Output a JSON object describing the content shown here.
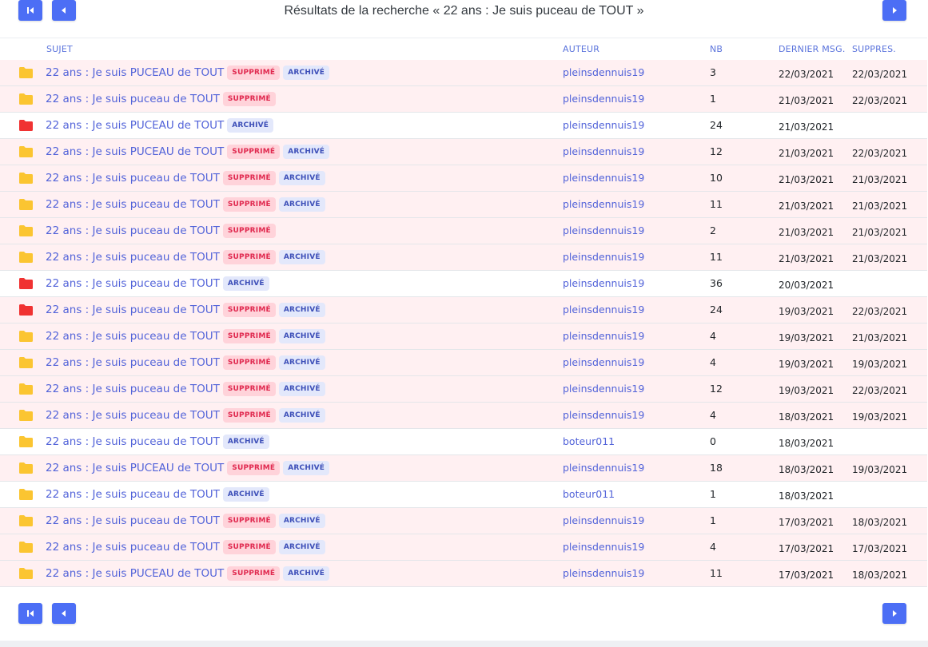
{
  "header": {
    "title": "Résultats de la recherche « 22 ans : Je suis puceau de TOUT »"
  },
  "nav": {
    "first_icon": "skip-first-icon",
    "prev_icon": "caret-left-icon",
    "next_icon": "caret-right-icon"
  },
  "columns": {
    "subject": "SUJET",
    "author": "AUTEUR",
    "nb": "NB",
    "last": "DERNIER MSG.",
    "deleted": "SUPPRES."
  },
  "badges": {
    "deleted": "SUPPRIMÉ",
    "archived": "ARCHIVÉ"
  },
  "colors": {
    "accent": "#4c6ef5",
    "folder_yellow": "#fbc531",
    "folder_red": "#f03232",
    "row_pink": "#fff0f2"
  },
  "rows": [
    {
      "subject": "22 ans : Je suis PUCEAU de TOUT",
      "deleted": true,
      "archived": true,
      "author": "pleinsdennuis19",
      "nb": "3",
      "last": "22/03/2021",
      "suppr": "22/03/2021",
      "folder": "yellow"
    },
    {
      "subject": "22 ans : Je suis puceau de TOUT",
      "deleted": true,
      "archived": false,
      "author": "pleinsdennuis19",
      "nb": "1",
      "last": "21/03/2021",
      "suppr": "22/03/2021",
      "folder": "yellow"
    },
    {
      "subject": "22 ans : Je suis PUCEAU de TOUT",
      "deleted": false,
      "archived": true,
      "author": "pleinsdennuis19",
      "nb": "24",
      "last": "21/03/2021",
      "suppr": "",
      "folder": "red"
    },
    {
      "subject": "22 ans : Je suis PUCEAU de TOUT",
      "deleted": true,
      "archived": true,
      "author": "pleinsdennuis19",
      "nb": "12",
      "last": "21/03/2021",
      "suppr": "22/03/2021",
      "folder": "yellow"
    },
    {
      "subject": "22 ans : Je suis puceau de TOUT",
      "deleted": true,
      "archived": true,
      "author": "pleinsdennuis19",
      "nb": "10",
      "last": "21/03/2021",
      "suppr": "21/03/2021",
      "folder": "yellow"
    },
    {
      "subject": "22 ans : Je suis puceau de TOUT",
      "deleted": true,
      "archived": true,
      "author": "pleinsdennuis19",
      "nb": "11",
      "last": "21/03/2021",
      "suppr": "21/03/2021",
      "folder": "yellow"
    },
    {
      "subject": "22 ans : Je suis puceau de TOUT",
      "deleted": true,
      "archived": false,
      "author": "pleinsdennuis19",
      "nb": "2",
      "last": "21/03/2021",
      "suppr": "21/03/2021",
      "folder": "yellow"
    },
    {
      "subject": "22 ans : Je suis puceau de TOUT",
      "deleted": true,
      "archived": true,
      "author": "pleinsdennuis19",
      "nb": "11",
      "last": "21/03/2021",
      "suppr": "21/03/2021",
      "folder": "yellow"
    },
    {
      "subject": "22 ans : Je suis puceau de TOUT",
      "deleted": false,
      "archived": true,
      "author": "pleinsdennuis19",
      "nb": "36",
      "last": "20/03/2021",
      "suppr": "",
      "folder": "red"
    },
    {
      "subject": "22 ans : Je suis puceau de TOUT",
      "deleted": true,
      "archived": true,
      "author": "pleinsdennuis19",
      "nb": "24",
      "last": "19/03/2021",
      "suppr": "22/03/2021",
      "folder": "red"
    },
    {
      "subject": "22 ans : Je suis puceau de TOUT",
      "deleted": true,
      "archived": true,
      "author": "pleinsdennuis19",
      "nb": "4",
      "last": "19/03/2021",
      "suppr": "21/03/2021",
      "folder": "yellow"
    },
    {
      "subject": "22 ans : Je suis puceau de TOUT",
      "deleted": true,
      "archived": true,
      "author": "pleinsdennuis19",
      "nb": "4",
      "last": "19/03/2021",
      "suppr": "19/03/2021",
      "folder": "yellow"
    },
    {
      "subject": "22 ans : Je suis puceau de TOUT",
      "deleted": true,
      "archived": true,
      "author": "pleinsdennuis19",
      "nb": "12",
      "last": "19/03/2021",
      "suppr": "22/03/2021",
      "folder": "yellow"
    },
    {
      "subject": "22 ans : Je suis puceau de TOUT",
      "deleted": true,
      "archived": true,
      "author": "pleinsdennuis19",
      "nb": "4",
      "last": "18/03/2021",
      "suppr": "19/03/2021",
      "folder": "yellow"
    },
    {
      "subject": "22 ans : Je suis puceau de TOUT",
      "deleted": false,
      "archived": true,
      "author": "boteur011",
      "nb": "0",
      "last": "18/03/2021",
      "suppr": "",
      "folder": "yellow"
    },
    {
      "subject": "22 ans : Je suis PUCEAU de TOUT",
      "deleted": true,
      "archived": true,
      "author": "pleinsdennuis19",
      "nb": "18",
      "last": "18/03/2021",
      "suppr": "19/03/2021",
      "folder": "yellow"
    },
    {
      "subject": "22 ans : Je suis puceau de TOUT",
      "deleted": false,
      "archived": true,
      "author": "boteur011",
      "nb": "1",
      "last": "18/03/2021",
      "suppr": "",
      "folder": "yellow"
    },
    {
      "subject": "22 ans : Je suis puceau de TOUT",
      "deleted": true,
      "archived": true,
      "author": "pleinsdennuis19",
      "nb": "1",
      "last": "17/03/2021",
      "suppr": "18/03/2021",
      "folder": "yellow"
    },
    {
      "subject": "22 ans : Je suis puceau de TOUT",
      "deleted": true,
      "archived": true,
      "author": "pleinsdennuis19",
      "nb": "4",
      "last": "17/03/2021",
      "suppr": "17/03/2021",
      "folder": "yellow"
    },
    {
      "subject": "22 ans : Je suis PUCEAU de TOUT",
      "deleted": true,
      "archived": true,
      "author": "pleinsdennuis19",
      "nb": "11",
      "last": "17/03/2021",
      "suppr": "18/03/2021",
      "folder": "yellow"
    }
  ]
}
